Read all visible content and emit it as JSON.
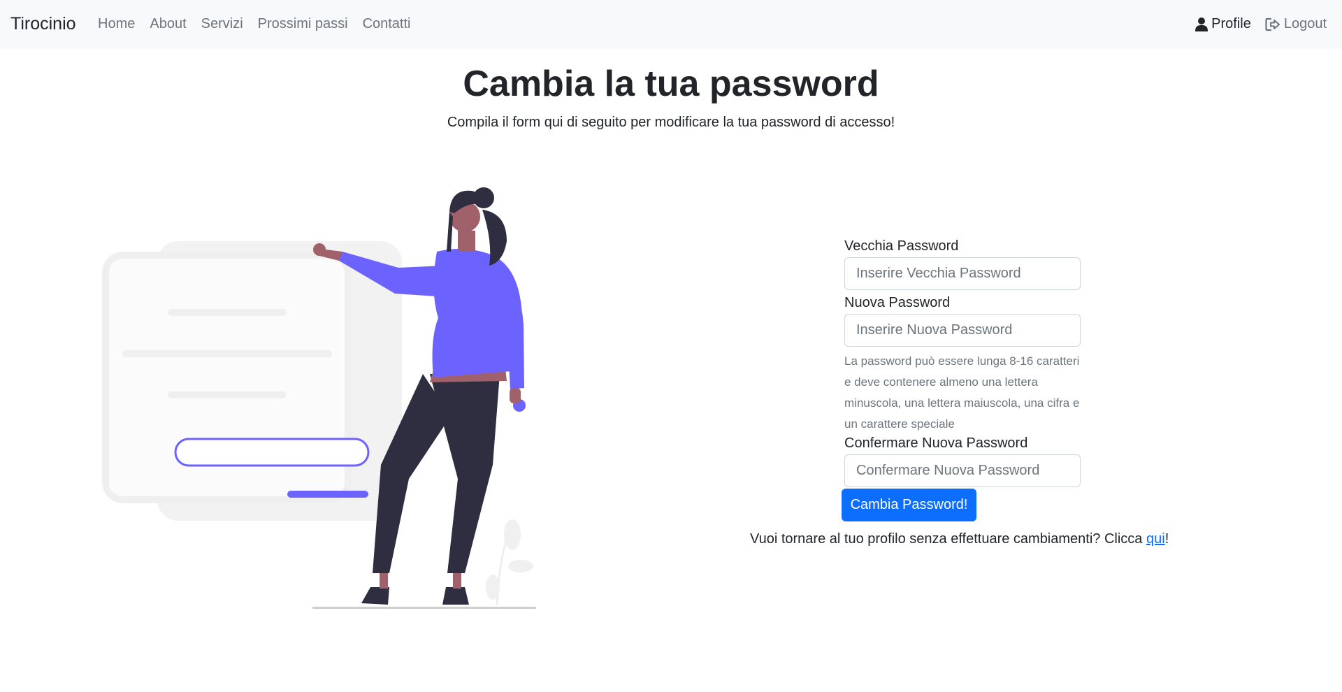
{
  "navbar": {
    "brand": "Tirocinio",
    "links": [
      "Home",
      "About",
      "Servizi",
      "Prossimi passi",
      "Contatti"
    ],
    "profile_label": "Profile",
    "profile_icon": "user-icon",
    "logout_label": "Logout",
    "logout_icon": "logout-icon"
  },
  "header": {
    "title": "Cambia la tua password",
    "subtitle": "Compila il form qui di seguito per modificare la tua password di accesso!"
  },
  "form": {
    "old_password": {
      "label": "Vecchia Password",
      "placeholder": "Inserire Vecchia Password"
    },
    "new_password": {
      "label": "Nuova Password",
      "placeholder": "Inserire Nuova Password"
    },
    "help_text": "La password può essere lunga 8-16 caratteri e deve contenere almeno una lettera minuscola, una lettera maiuscola, una cifra e un carattere speciale",
    "confirm_password": {
      "label": "Confermare Nuova Password",
      "placeholder": "Confermare Nuova Password"
    },
    "submit_label": "Cambia Password!"
  },
  "back": {
    "text": "Vuoi tornare al tuo profilo senza effettuare cambiamenti? Clicca ",
    "link_label": "qui",
    "suffix": "!"
  },
  "colors": {
    "accent": "#6c63ff",
    "primary": "#0d6efd",
    "navbar_bg": "#f8f9fa"
  }
}
